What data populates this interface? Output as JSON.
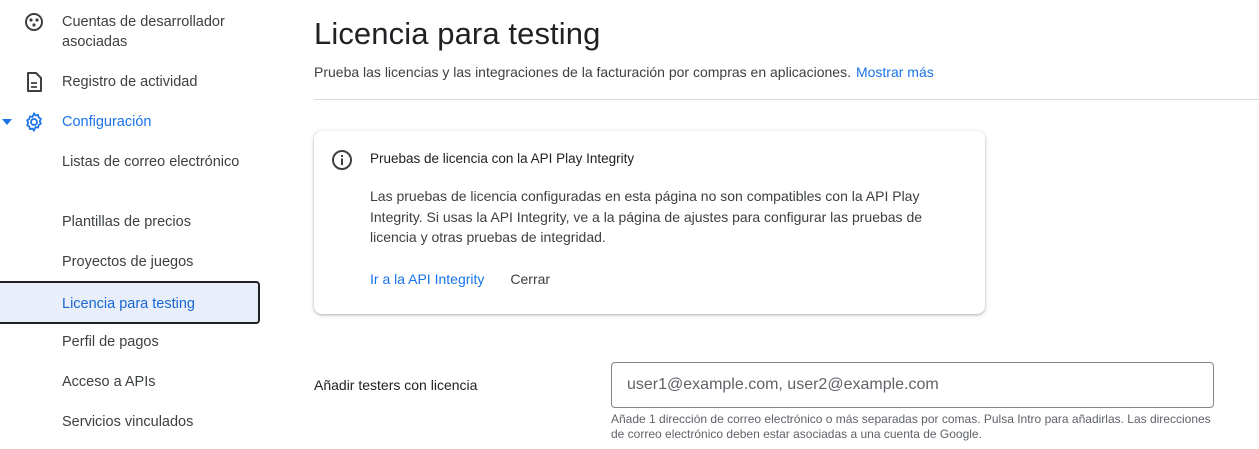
{
  "sidebar": {
    "items": [
      {
        "label": "Cuentas de desarrollador asociadas",
        "icon": "developer-accounts-icon"
      },
      {
        "label": "Registro de actividad",
        "icon": "document-icon"
      },
      {
        "label": "Configuración",
        "icon": "gear-icon",
        "expanded": true
      },
      {
        "label": "Listas de correo electrónico"
      },
      {
        "label": "Plantillas de precios"
      },
      {
        "label": "Proyectos de juegos"
      },
      {
        "label": "Licencia para testing",
        "selected": true
      },
      {
        "label": "Perfil de pagos"
      },
      {
        "label": "Acceso a APIs"
      },
      {
        "label": "Servicios vinculados"
      }
    ]
  },
  "main": {
    "title": "Licencia para testing",
    "description": "Prueba las licencias y las integraciones de la facturación por compras en aplicaciones.",
    "show_more": "Mostrar más",
    "card": {
      "title": "Pruebas de licencia con la API Play Integrity",
      "body": "Las pruebas de licencia configuradas en esta página no son compatibles con la API Play Integrity. Si usas la API Integrity, ve a la página de ajustes para configurar las pruebas de licencia y otras pruebas de integridad.",
      "primary_action": "Ir a la API Integrity",
      "secondary_action": "Cerrar"
    },
    "testers": {
      "label": "Añadir testers con licencia",
      "placeholder": "user1@example.com, user2@example.com",
      "value": "",
      "help": "Añade 1 dirección de correo electrónico o más separadas por comas. Pulsa Intro para añadirlas. Las direcciones de correo electrónico deben estar asociadas a una cuenta de Google."
    }
  },
  "colors": {
    "accent": "#1a73e8",
    "selected_bg": "#e8eefa",
    "text": "#202124",
    "secondary_text": "#3c4043"
  }
}
